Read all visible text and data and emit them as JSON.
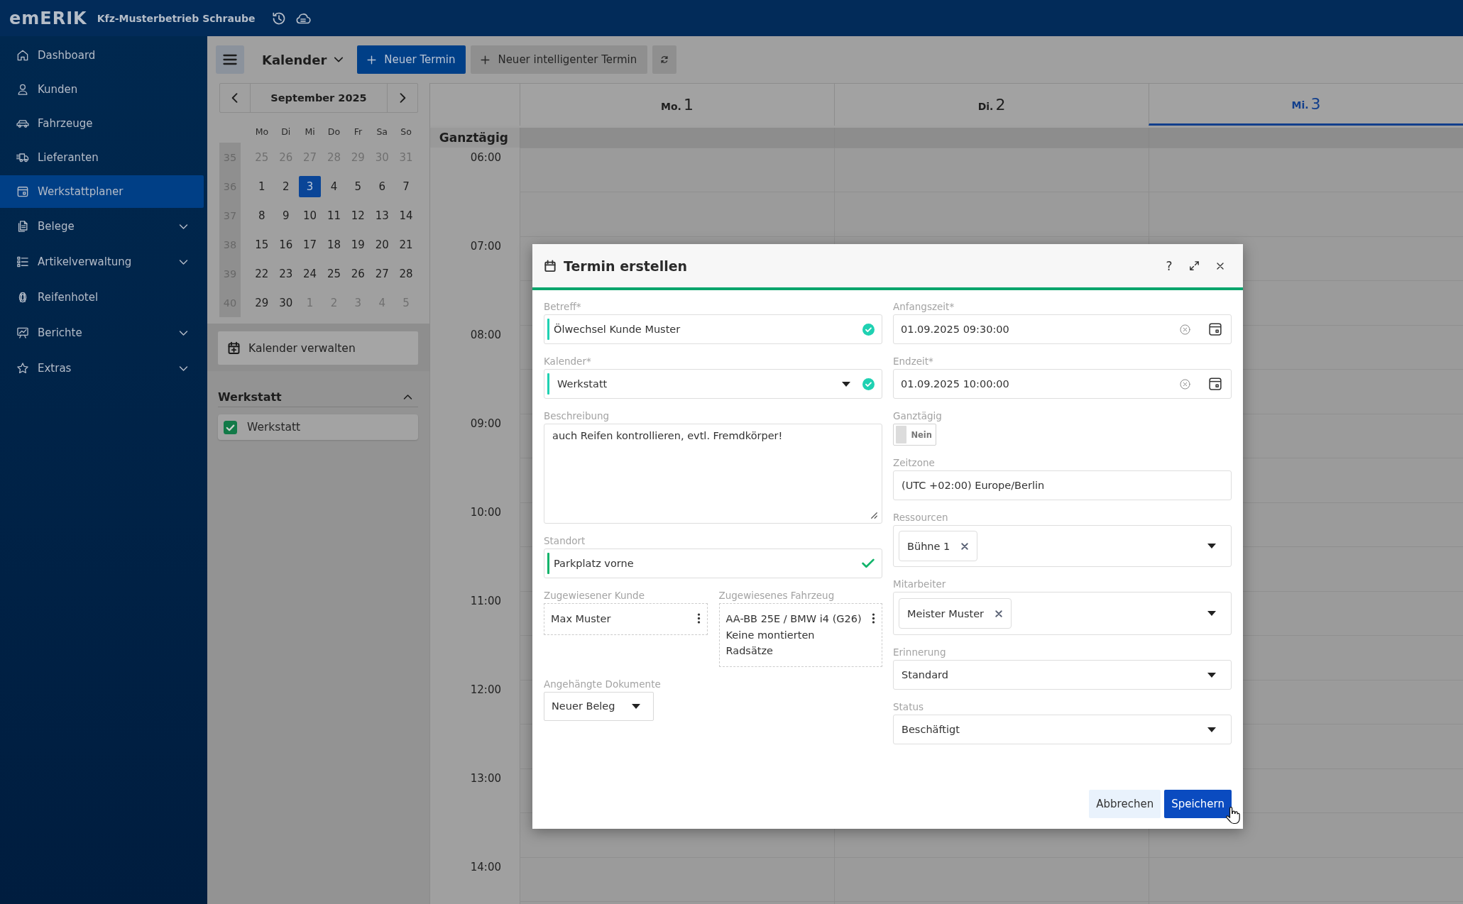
{
  "header": {
    "logo": "emERIK",
    "company": "Kfz-Musterbetrieb Schraube"
  },
  "sidebar": {
    "items": [
      {
        "label": "Dashboard",
        "selected": false,
        "has_submenu": false
      },
      {
        "label": "Kunden",
        "selected": false,
        "has_submenu": false
      },
      {
        "label": "Fahrzeuge",
        "selected": false,
        "has_submenu": false
      },
      {
        "label": "Lieferanten",
        "selected": false,
        "has_submenu": false
      },
      {
        "label": "Werkstattplaner",
        "selected": true,
        "has_submenu": false
      },
      {
        "label": "Belege",
        "selected": false,
        "has_submenu": true
      },
      {
        "label": "Artikelverwaltung",
        "selected": false,
        "has_submenu": true
      },
      {
        "label": "Reifenhotel",
        "selected": false,
        "has_submenu": false
      },
      {
        "label": "Berichte",
        "selected": false,
        "has_submenu": true
      },
      {
        "label": "Extras",
        "selected": false,
        "has_submenu": true
      }
    ]
  },
  "toolbar": {
    "view": "Kalender",
    "buttons": [
      {
        "kind": "primary",
        "label": "Neuer Termin"
      },
      {
        "kind": "secondary",
        "label": "Neuer intelligenter Termin"
      },
      {
        "kind": "refresh"
      }
    ]
  },
  "calendar_panel": {
    "mini_calendar": {
      "month": "September 2025",
      "weekdays": [
        "Mo",
        "Di",
        "Mi",
        "Do",
        "Fr",
        "Sa",
        "So"
      ],
      "weeks": [
        {
          "number": "35",
          "days": [
            {
              "label": "25",
              "outside": true,
              "selected": false
            },
            {
              "label": "26",
              "outside": true,
              "selected": false
            },
            {
              "label": "27",
              "outside": true,
              "selected": false
            },
            {
              "label": "28",
              "outside": true,
              "selected": false
            },
            {
              "label": "29",
              "outside": true,
              "selected": false
            },
            {
              "label": "30",
              "outside": true,
              "selected": false
            },
            {
              "label": "31",
              "outside": true,
              "selected": false
            }
          ]
        },
        {
          "number": "36",
          "days": [
            {
              "label": "1",
              "outside": false,
              "selected": false
            },
            {
              "label": "2",
              "outside": false,
              "selected": false
            },
            {
              "label": "3",
              "outside": false,
              "selected": true
            },
            {
              "label": "4",
              "outside": false,
              "selected": false
            },
            {
              "label": "5",
              "outside": false,
              "selected": false
            },
            {
              "label": "6",
              "outside": false,
              "selected": false
            },
            {
              "label": "7",
              "outside": false,
              "selected": false
            }
          ]
        },
        {
          "number": "37",
          "days": [
            {
              "label": "8",
              "outside": false,
              "selected": false
            },
            {
              "label": "9",
              "outside": false,
              "selected": false
            },
            {
              "label": "10",
              "outside": false,
              "selected": false
            },
            {
              "label": "11",
              "outside": false,
              "selected": false
            },
            {
              "label": "12",
              "outside": false,
              "selected": false
            },
            {
              "label": "13",
              "outside": false,
              "selected": false
            },
            {
              "label": "14",
              "outside": false,
              "selected": false
            }
          ]
        },
        {
          "number": "38",
          "days": [
            {
              "label": "15",
              "outside": false,
              "selected": false
            },
            {
              "label": "16",
              "outside": false,
              "selected": false
            },
            {
              "label": "17",
              "outside": false,
              "selected": false
            },
            {
              "label": "18",
              "outside": false,
              "selected": false
            },
            {
              "label": "19",
              "outside": false,
              "selected": false
            },
            {
              "label": "20",
              "outside": false,
              "selected": false
            },
            {
              "label": "21",
              "outside": false,
              "selected": false
            }
          ]
        },
        {
          "number": "39",
          "days": [
            {
              "label": "22",
              "outside": false,
              "selected": false
            },
            {
              "label": "23",
              "outside": false,
              "selected": false
            },
            {
              "label": "24",
              "outside": false,
              "selected": false
            },
            {
              "label": "25",
              "outside": false,
              "selected": false
            },
            {
              "label": "26",
              "outside": false,
              "selected": false
            },
            {
              "label": "27",
              "outside": false,
              "selected": false
            },
            {
              "label": "28",
              "outside": false,
              "selected": false
            }
          ]
        },
        {
          "number": "40",
          "days": [
            {
              "label": "29",
              "outside": false,
              "selected": false
            },
            {
              "label": "30",
              "outside": false,
              "selected": false
            },
            {
              "label": "1",
              "outside": true,
              "selected": false
            },
            {
              "label": "2",
              "outside": true,
              "selected": false
            },
            {
              "label": "3",
              "outside": true,
              "selected": false
            },
            {
              "label": "4",
              "outside": true,
              "selected": false
            },
            {
              "label": "5",
              "outside": true,
              "selected": false
            }
          ]
        }
      ]
    },
    "manage_button": "Kalender verwalten",
    "group": {
      "title": "Werkstatt",
      "expanded": true,
      "calendars": [
        {
          "label": "Werkstatt",
          "checked": true,
          "color": "#127a48"
        }
      ]
    }
  },
  "week_view": {
    "all_day_label": "Ganztägig",
    "days": [
      {
        "weekday": "Mo.",
        "date": "1",
        "today": false
      },
      {
        "weekday": "Di.",
        "date": "2",
        "today": false
      },
      {
        "weekday": "Mi.",
        "date": "3",
        "today": true
      }
    ],
    "hours": [
      "06:00",
      "07:00",
      "08:00",
      "09:00",
      "10:00",
      "11:00",
      "12:00",
      "13:00",
      "14:00"
    ]
  },
  "dialog": {
    "title": "Termin erstellen",
    "help": "?",
    "left": [
      {
        "kind": "text",
        "label": "Betreff*",
        "value": "Ölwechsel Kunde Muster",
        "valid": true,
        "check_filled": true
      },
      {
        "kind": "select",
        "label": "Kalender*",
        "value": "Werkstatt",
        "valid": true,
        "check_filled": true
      },
      {
        "kind": "textarea",
        "label": "Beschreibung",
        "value": "auch Reifen kontrollieren, evtl. Fremdkörper!"
      },
      {
        "kind": "text",
        "label": "Standort",
        "value": "Parkplatz vorne",
        "valid": true,
        "check_filled": false
      },
      {
        "kind": "assignments",
        "items": [
          {
            "label": "Zugewiesener Kunde",
            "lines": [
              "Max Muster"
            ]
          },
          {
            "label": "Zugewiesenes Fahrzeug",
            "lines": [
              "AA-BB 25E / BMW i4 (G26)",
              "Keine montierten Radsätze"
            ]
          }
        ]
      },
      {
        "kind": "documents",
        "label": "Angehängte Dokumente",
        "button": "Neuer Beleg"
      }
    ],
    "right": [
      {
        "kind": "datetime",
        "label": "Anfangszeit*",
        "value": "01.09.2025 09:30:00"
      },
      {
        "kind": "datetime",
        "label": "Endzeit*",
        "value": "01.09.2025 10:00:00"
      },
      {
        "kind": "toggle",
        "label": "Ganztägig",
        "on": false,
        "value": "Nein"
      },
      {
        "kind": "text",
        "label": "Zeitzone",
        "value": "(UTC +02:00) Europe/Berlin"
      },
      {
        "kind": "multiselect",
        "label": "Ressourcen",
        "chips": [
          "Bühne 1"
        ]
      },
      {
        "kind": "multiselect",
        "label": "Mitarbeiter",
        "chips": [
          "Meister Muster"
        ]
      },
      {
        "kind": "select",
        "label": "Erinnerung",
        "value": "Standard"
      },
      {
        "kind": "select",
        "label": "Status",
        "value": "Beschäftigt"
      }
    ],
    "buttons": [
      {
        "kind": "secondary",
        "label": "Abbrechen"
      },
      {
        "kind": "primary",
        "label": "Speichern"
      }
    ]
  }
}
